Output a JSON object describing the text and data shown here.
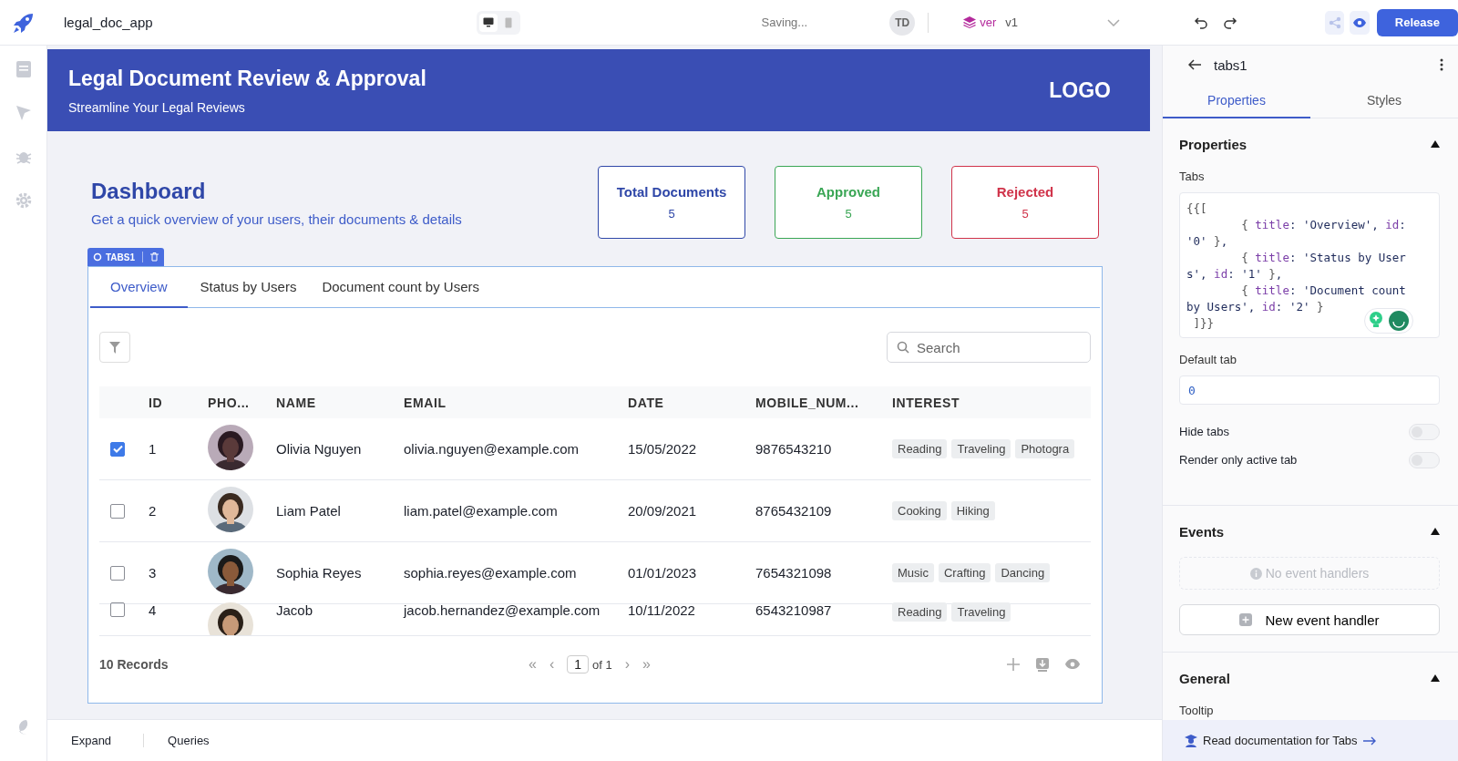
{
  "top_bar": {
    "app_name": "legal_doc_app",
    "view_modes": [
      {
        "kind": "desktop",
        "selected": true
      },
      {
        "kind": "mobile",
        "selected": false
      }
    ],
    "status": "Saving...",
    "avatar": "TD",
    "version_label": "ver",
    "version": "v1",
    "release_button": "Release"
  },
  "banner": {
    "title": "Legal Document Review & Approval",
    "subtitle": "Streamline Your Legal Reviews",
    "logo": "LOGO"
  },
  "dashboard": {
    "title": "Dashboard",
    "subtitle": "Get a quick overview of your users, their documents & details",
    "stats": [
      {
        "label": "Total Documents",
        "value": "5",
        "color": "#2f47a8"
      },
      {
        "label": "Approved",
        "value": "5",
        "color": "#3aa655"
      },
      {
        "label": "Rejected",
        "value": "5",
        "color": "#d0334a"
      }
    ]
  },
  "tabs_widget": {
    "badge": "TABS1",
    "tabs": [
      {
        "label": "Overview",
        "selected": true
      },
      {
        "label": "Status by Users",
        "selected": false
      },
      {
        "label": "Document count by Users",
        "selected": false
      }
    ],
    "table": {
      "search": {
        "placeholder": "Search"
      },
      "columns": [
        "ID",
        "PHO...",
        "NAME",
        "EMAIL",
        "DATE",
        "MOBILE_NUM...",
        "INTEREST"
      ],
      "rows": [
        {
          "selected": true,
          "id": "1",
          "name": "Olivia Nguyen",
          "email": "olivia.nguyen@example.com",
          "date": "15/05/2022",
          "mobile": "9876543210",
          "interests": [
            "Reading",
            "Traveling",
            "Photogra"
          ]
        },
        {
          "selected": false,
          "id": "2",
          "name": "Liam Patel",
          "email": "liam.patel@example.com",
          "date": "20/09/2021",
          "mobile": "8765432109",
          "interests": [
            "Cooking",
            "Hiking"
          ]
        },
        {
          "selected": false,
          "id": "3",
          "name": "Sophia Reyes",
          "email": "sophia.reyes@example.com",
          "date": "01/01/2023",
          "mobile": "7654321098",
          "interests": [
            "Music",
            "Crafting",
            "Dancing"
          ]
        },
        {
          "selected": false,
          "id": "4",
          "name": "Jacob",
          "email": "jacob.hernandez@example.com",
          "date": "10/11/2022",
          "mobile": "6543210987",
          "interests": [
            "Reading",
            "Traveling"
          ]
        }
      ],
      "records": "10 Records",
      "pagination": {
        "first": "«",
        "prev": "‹",
        "page": "1",
        "of": "of 1",
        "next": "›",
        "last": "»"
      }
    }
  },
  "bottom_bar": {
    "items": [
      "Expand",
      "Queries"
    ]
  },
  "inspector": {
    "component": "tabs1",
    "tabs": [
      {
        "label": "Properties",
        "selected": true
      },
      {
        "label": "Styles",
        "selected": false
      }
    ],
    "properties": {
      "title": "Properties",
      "expanded": true,
      "tabs_label": "Tabs",
      "code_lines": [
        "{{[",
        "        { title: 'Overview', id:",
        "'0' },",
        "        { title: 'Status by User",
        "s', id: '1' },",
        "        { title: 'Document count",
        "by Users', id: '2' }",
        " ]}}"
      ],
      "default_tab_label": "Default tab",
      "default_tab_value": "0",
      "toggles": [
        {
          "label": "Hide tabs",
          "on": false
        },
        {
          "label": "Render only active tab",
          "on": false
        }
      ]
    },
    "events": {
      "title": "Events",
      "expanded": true,
      "empty": "No event handlers",
      "add_button": "New event handler"
    },
    "general": {
      "title": "General",
      "expanded": true,
      "fields": [
        "Tooltip"
      ]
    },
    "doc_link": "Read documentation for Tabs"
  }
}
